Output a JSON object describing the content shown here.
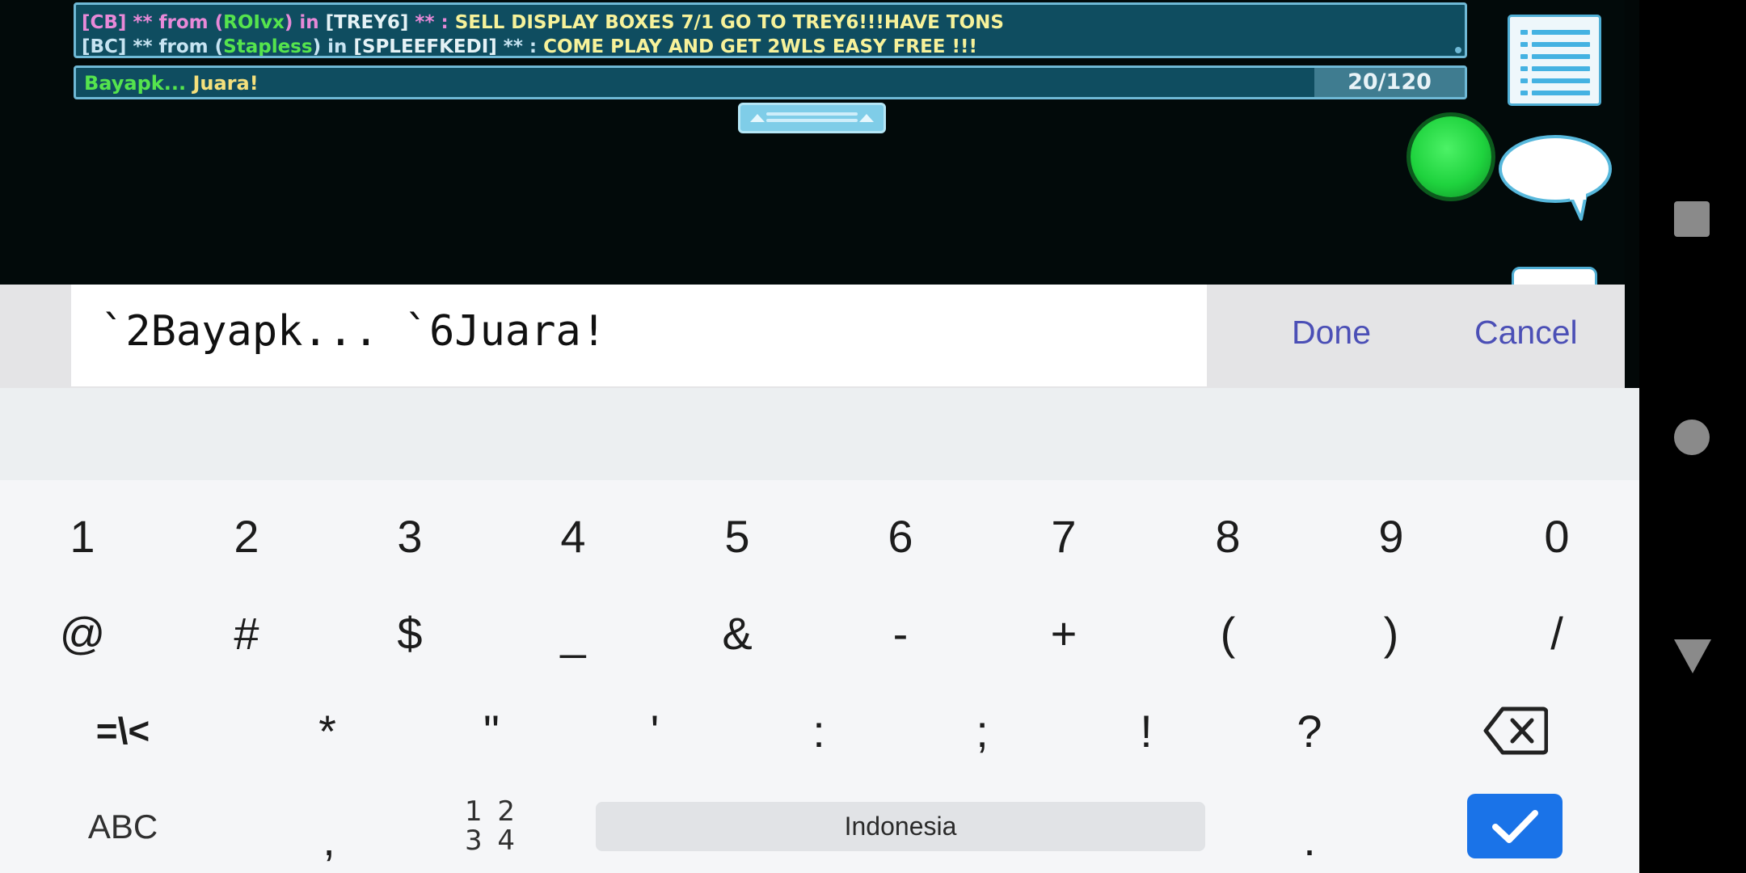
{
  "chat": {
    "line1": {
      "tag": "[CB]",
      "from_pre": " ** from (",
      "user": "ROIvx",
      "from_post": ") in ",
      "world": "[TREY6]",
      "stars": " ** : ",
      "message": "SELL DISPLAY BOXES 7/1 GO TO TREY6!!!HAVE TONS"
    },
    "line2": {
      "tag": "[BC]",
      "from_pre": " ** from (",
      "user": "Stapless",
      "from_post": ") in ",
      "world": "[SPLEEFKEDI]",
      "stars": " ** : ",
      "message": "COME PLAY AND GET 2WLS EASY FREE !!!"
    }
  },
  "input": {
    "part1": "Bayapk...",
    "part2": " Juara!",
    "counter": "20/120"
  },
  "edit": {
    "text": "`2Bayapk... `6Juara!",
    "done": "Done",
    "cancel": "Cancel"
  },
  "keyboard": {
    "row1": [
      "1",
      "2",
      "3",
      "4",
      "5",
      "6",
      "7",
      "8",
      "9",
      "0"
    ],
    "row2": [
      "@",
      "#",
      "$",
      "_",
      "&",
      "-",
      "+",
      "(",
      ")",
      "/"
    ],
    "row3": [
      "=\\<",
      "*",
      "\"",
      "'",
      ":",
      ";",
      "!",
      "?"
    ],
    "abc": "ABC",
    "comma": ",",
    "num_top": "1 2",
    "num_bottom": "3 4",
    "space": "Indonesia",
    "period": "."
  },
  "icons": {
    "menu": "list-menu-icon",
    "speech": "speech-bubble-icon",
    "status": "green-orb-icon",
    "backspace": "backspace-icon",
    "enter": "checkmark-icon",
    "nav_recents": "square-icon",
    "nav_home": "circle-icon",
    "nav_back": "triangle-icon"
  },
  "colors": {
    "chat_bg": "#0f4d60",
    "accent_blue": "#1a73e8",
    "link_purple": "#4b4fb6",
    "status_green": "#1fd33e"
  }
}
